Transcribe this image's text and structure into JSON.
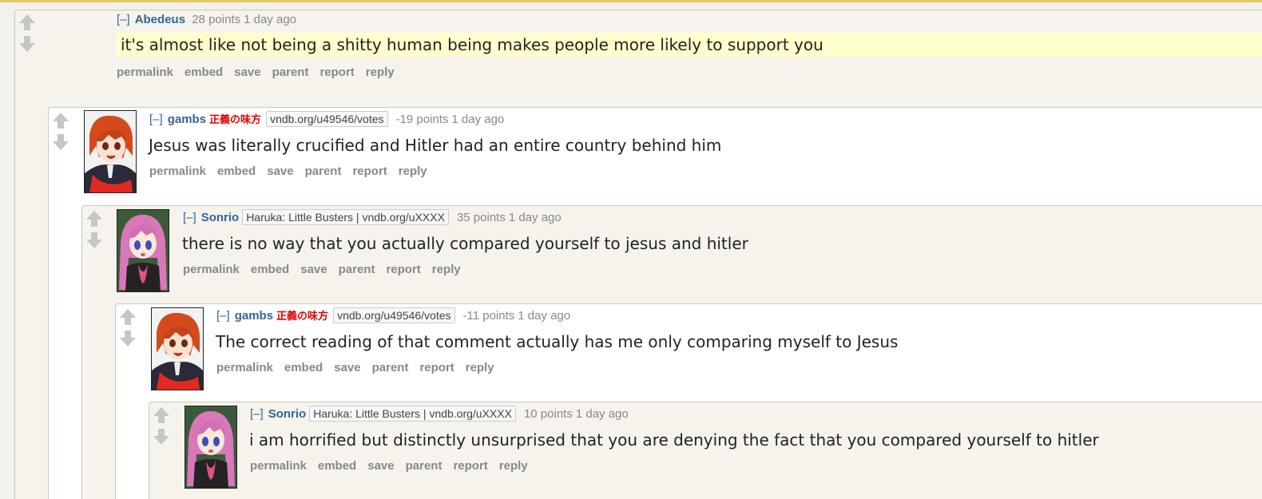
{
  "comments": [
    {
      "expand": "[–]",
      "author": "Abedeus",
      "badge": "",
      "flair": "",
      "score": "28 points",
      "time": "1 day ago",
      "body": "it's almost like not being a shitty human being makes people more likely to support you",
      "buttons": [
        "permalink",
        "embed",
        "save",
        "parent",
        "report",
        "reply"
      ]
    },
    {
      "expand": "[–]",
      "author": "gambs",
      "badge": "正義の味方",
      "flair": "vndb.org/u49546/votes",
      "score": "-19 points",
      "time": "1 day ago",
      "body": "Jesus was literally crucified and Hitler had an entire country behind him",
      "buttons": [
        "permalink",
        "embed",
        "save",
        "parent",
        "report",
        "reply"
      ]
    },
    {
      "expand": "[–]",
      "author": "Sonrio",
      "badge": "",
      "flair": "Haruka: Little Busters | vndb.org/uXXXX",
      "score": "35 points",
      "time": "1 day ago",
      "body": "there is no way that you actually compared yourself to jesus and hitler",
      "buttons": [
        "permalink",
        "embed",
        "save",
        "parent",
        "report",
        "reply"
      ]
    },
    {
      "expand": "[–]",
      "author": "gambs",
      "badge": "正義の味方",
      "flair": "vndb.org/u49546/votes",
      "score": "-11 points",
      "time": "1 day ago",
      "body": "The correct reading of that comment actually has me only comparing myself to Jesus",
      "buttons": [
        "permalink",
        "embed",
        "save",
        "parent",
        "report",
        "reply"
      ]
    },
    {
      "expand": "[–]",
      "author": "Sonrio",
      "badge": "",
      "flair": "Haruka: Little Busters | vndb.org/uXXXX",
      "score": "10 points",
      "time": "1 day ago",
      "body": "i am horrified but distinctly unsurprised that you are denying the fact that you compared yourself to hitler",
      "buttons": [
        "permalink",
        "embed",
        "save",
        "parent",
        "report",
        "reply"
      ]
    }
  ],
  "icons": {
    "upvote": "upvote-arrow-icon",
    "downvote": "downvote-arrow-icon"
  },
  "colors": {
    "author": "#336699",
    "badge": "#e00000",
    "highlight": "#ffffcc",
    "muted": "#888888"
  }
}
